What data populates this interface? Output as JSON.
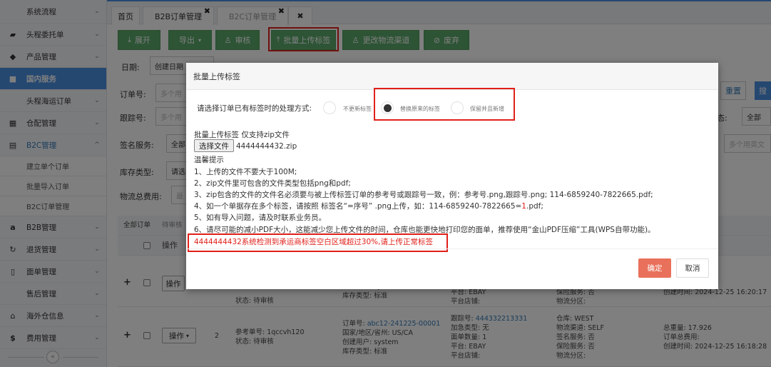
{
  "sidebar": {
    "items": [
      {
        "label": "系统流程",
        "icon": "",
        "chev": "⌄"
      },
      {
        "label": "头程委托单",
        "icon": "briefcase-icon",
        "chev": "⌄"
      },
      {
        "label": "产品管理",
        "icon": "tag-icon",
        "chev": "⌄"
      },
      {
        "label": "国内服务",
        "icon": "folder-icon",
        "chev": ""
      },
      {
        "label": "头程海运订单",
        "icon": "",
        "chev": "⌄"
      },
      {
        "label": "仓配管理",
        "icon": "grid-icon",
        "chev": "⌄"
      },
      {
        "label": "B2C管理",
        "icon": "cart-icon",
        "chev": "^"
      },
      {
        "label": "建立单个订单",
        "icon": "",
        "chev": ""
      },
      {
        "label": "批量导入订单",
        "icon": "",
        "chev": ""
      },
      {
        "label": "B2C订单管理",
        "icon": "",
        "chev": ""
      },
      {
        "label": "B2B管理",
        "icon": "amazon-icon",
        "chev": "⌄"
      },
      {
        "label": "退货管理",
        "icon": "return-icon",
        "chev": "⌄"
      },
      {
        "label": "面单管理",
        "icon": "document-icon",
        "chev": "⌄"
      },
      {
        "label": "售后管理",
        "icon": "",
        "chev": "⌄"
      },
      {
        "label": "海外仓信息",
        "icon": "home-icon",
        "chev": "⌄"
      },
      {
        "label": "费用管理",
        "icon": "dollar-icon",
        "chev": "⌄"
      }
    ],
    "collapse_icon": "«"
  },
  "tabs": [
    {
      "label": "首页"
    },
    {
      "label": "B2B订单管理",
      "close": "✖"
    },
    {
      "label": "B2C订单管理",
      "close": "✖"
    },
    {
      "label": "✖"
    }
  ],
  "toolbar": {
    "expand": "展开",
    "export": "导出",
    "audit": "审核",
    "batch_upload": "批量上传标签",
    "change_channel": "更改物流渠道",
    "discard": "废弃"
  },
  "filters": {
    "date_label": "日期:",
    "date_value": "创建日期",
    "order_no_label": "订单号:",
    "order_no_placeholder": "多个用",
    "tracking_label": "跟踪号:",
    "tracking_placeholder": "多个用",
    "sign_label": "签名服务:",
    "sign_value": "全部",
    "stock_label": "库存类型:",
    "stock_value": "请选",
    "fee_label": "物流总费用:",
    "fee_placeholder": "最",
    "reset": "重置",
    "search": "搜",
    "status_label": "态:",
    "status_value": "全部",
    "multi_placeholder": "多个用英文"
  },
  "table": {
    "tab_all": "全部订单",
    "tab_pending": "待审核",
    "header_op": "操作",
    "op_label": "操作",
    "rows": [
      {
        "status": "状态: 待审核",
        "creator": "创建用户: system",
        "stock": "库存类型: 标准",
        "platform": "平台: EBAY",
        "shop": "平台店铺:",
        "insurance": "保险服务: 否",
        "area": "物流分区:",
        "created": "创建时间: 2024-12-25 16:20:17"
      },
      {
        "index": "2",
        "ref": "参考单号: 1qccvh120",
        "status": "状态: 待审核",
        "order_no_label": "订单号:",
        "order_no": "abc12-241225-00001",
        "country": "国家/地区/省州: US/CA",
        "creator": "创建用户: system",
        "stock": "库存类型: 标准",
        "track_label": "跟踪号:",
        "track": "444332213331",
        "add_type": "加急类型: 无",
        "qty": "面单数量: 1",
        "platform": "平台: EBAY",
        "shop": "平台店铺:",
        "warehouse": "仓库: WEST",
        "channel": "物流渠道: SELF",
        "sign": "签名服务: 否",
        "insurance": "保险服务: 否",
        "area": "物流分区:",
        "weight": "总重量: 17.926",
        "total_fee": "订单总费用:",
        "created": "创建时间: 2024-12-25 16:18:28"
      }
    ]
  },
  "modal": {
    "title": "批量上传标签",
    "prompt": "请选择订单已有标签时的处理方式:",
    "options": [
      "不更新标签",
      "替换原来的标签",
      "保留并且新增"
    ],
    "selected_index": 1,
    "upload_label": "批量上传标签 仅支持zip文件",
    "file_button": "选择文件",
    "file_name": "4444444432.zip",
    "tips_title": "温馨提示",
    "tips": [
      "1、上传的文件不要大于100M;",
      "2、zip文件里可包含的文件类型包括png和pdf;",
      "3、zip包含的文件的文件名必须要与被上传标签订单的参考号或跟踪号一致，例：参考号.png,跟踪号.png; 114-6859240-7822665.pdf;",
      "4、如一个单据存在多个标签，请按照 标签名“=序号” .png上传，如：114-6859240-7822665=",
      "5、如有导入问题，请及时联系业务员。",
      "6、请尽可能的减小PDF大小，这能减少您上传文件的时间，仓库也能更快地打印您的面单，推荐使用“金山PDF压缩”工具(WPS自带功能)。"
    ],
    "tip4_highlight": "1",
    "tip4_suffix": ".pdf;",
    "error": "4444444432系统检测到承运商标签空白区域超过30%,请上传正常标签",
    "ok": "确定",
    "cancel": "取消"
  },
  "colors": {
    "primary": "#4a90e2",
    "toolbar_green": "#5aa86a",
    "highlight_red": "#e0201a",
    "ok_button": "#e9705a"
  }
}
